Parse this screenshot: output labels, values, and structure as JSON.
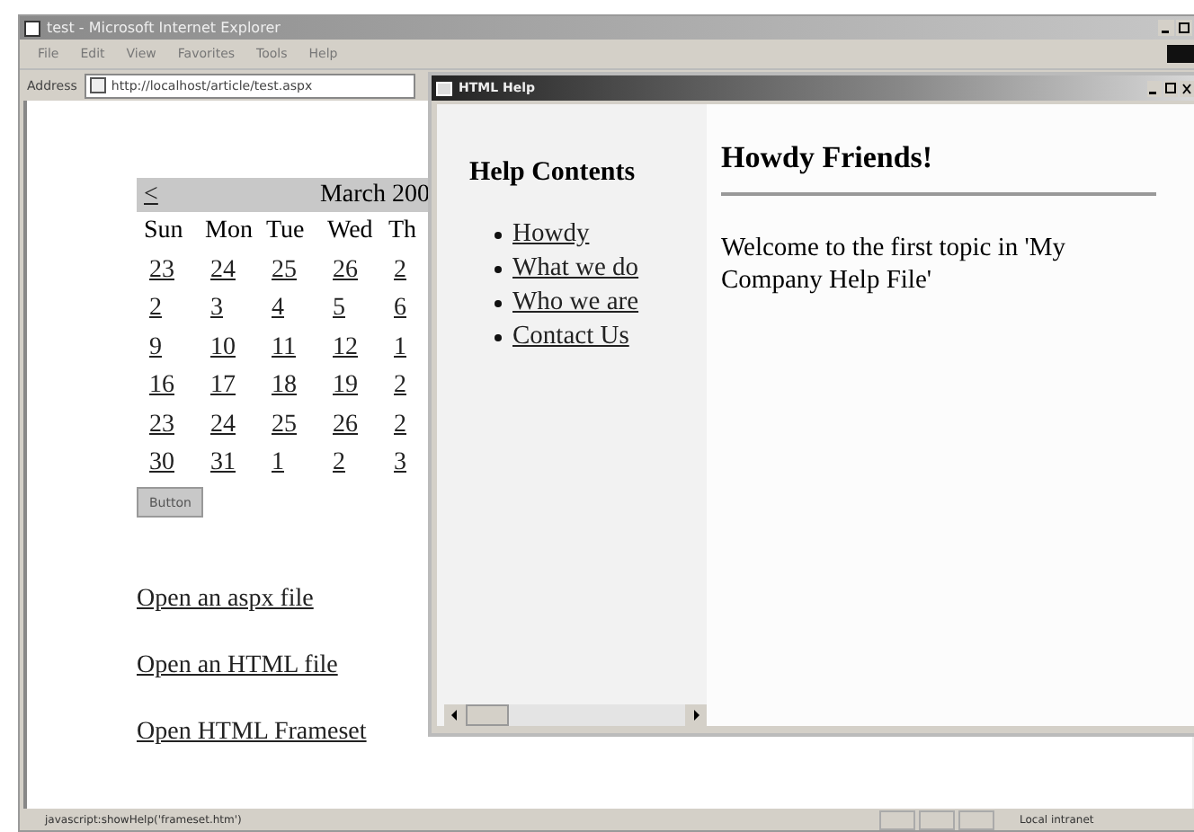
{
  "browser": {
    "title": "test - Microsoft Internet Explorer",
    "menu": [
      "File",
      "Edit",
      "View",
      "Favorites",
      "Tools",
      "Help"
    ],
    "address_label": "Address",
    "address": "http://localhost/article/test.aspx"
  },
  "calendar": {
    "prev": "<",
    "month": "March 200",
    "weekdays": [
      "Sun",
      "Mon",
      "Tue",
      "Wed",
      "Th"
    ],
    "weeks": [
      [
        "23",
        "24",
        "25",
        "26",
        "2"
      ],
      [
        "2",
        "3",
        "4",
        "5",
        "6"
      ],
      [
        "9",
        "10",
        "11",
        "12",
        "1"
      ],
      [
        "16",
        "17",
        "18",
        "19",
        "2"
      ],
      [
        "23",
        "24",
        "25",
        "26",
        "2"
      ],
      [
        "30",
        "31",
        "1",
        "2",
        "3"
      ]
    ]
  },
  "button": "Button",
  "links": [
    "Open an aspx file",
    "Open an HTML file",
    "Open HTML Frameset"
  ],
  "status_bar": {
    "text": "javascript:showHelp('frameset.htm')",
    "zone": "Local intranet"
  },
  "help_window": {
    "title": "HTML Help",
    "contents_title": "Help Contents",
    "topics": [
      "Howdy",
      "What we do",
      "Who we are",
      "Contact Us"
    ],
    "heading": "Howdy Friends!",
    "body": "Welcome to the first topic in 'My Company Help File'"
  }
}
